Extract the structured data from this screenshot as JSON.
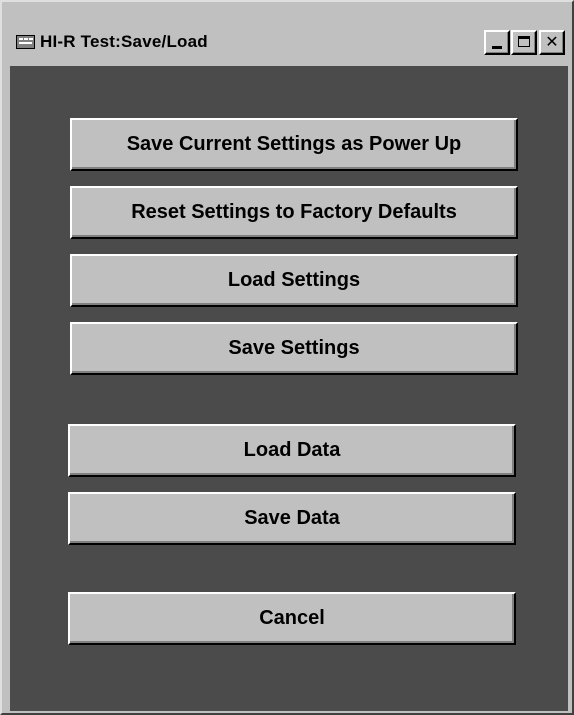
{
  "window": {
    "title": "HI-R Test:Save/Load",
    "app_icon": "window-app-icon",
    "controls": {
      "minimize_icon": "minimize-icon",
      "maximize_icon": "maximize-icon",
      "close_label": "✕"
    }
  },
  "actions": {
    "save_power_up": "Save Current Settings as Power Up",
    "reset_defaults": "Reset Settings to Factory Defaults",
    "load_settings": "Load Settings",
    "save_settings": "Save Settings",
    "load_data": "Load Data",
    "save_data": "Save Data",
    "cancel": "Cancel"
  },
  "colors": {
    "window_face": "#c0c0c0",
    "client_background": "#4b4b4b",
    "button_face": "#c0c0c0",
    "text": "#000000"
  }
}
